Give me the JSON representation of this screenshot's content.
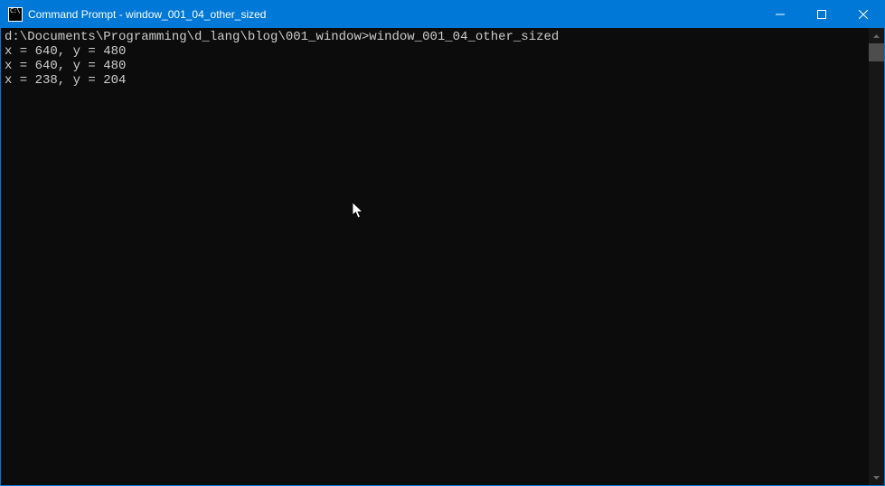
{
  "titlebar": {
    "title": "Command Prompt - window_001_04_other_sized"
  },
  "terminal": {
    "prompt_path": "d:\\Documents\\Programming\\d_lang\\blog\\001_window>",
    "command": "window_001_04_other_sized",
    "lines": [
      "x = 640, y = 480",
      "x = 640, y = 480",
      "x = 238, y = 204"
    ]
  }
}
